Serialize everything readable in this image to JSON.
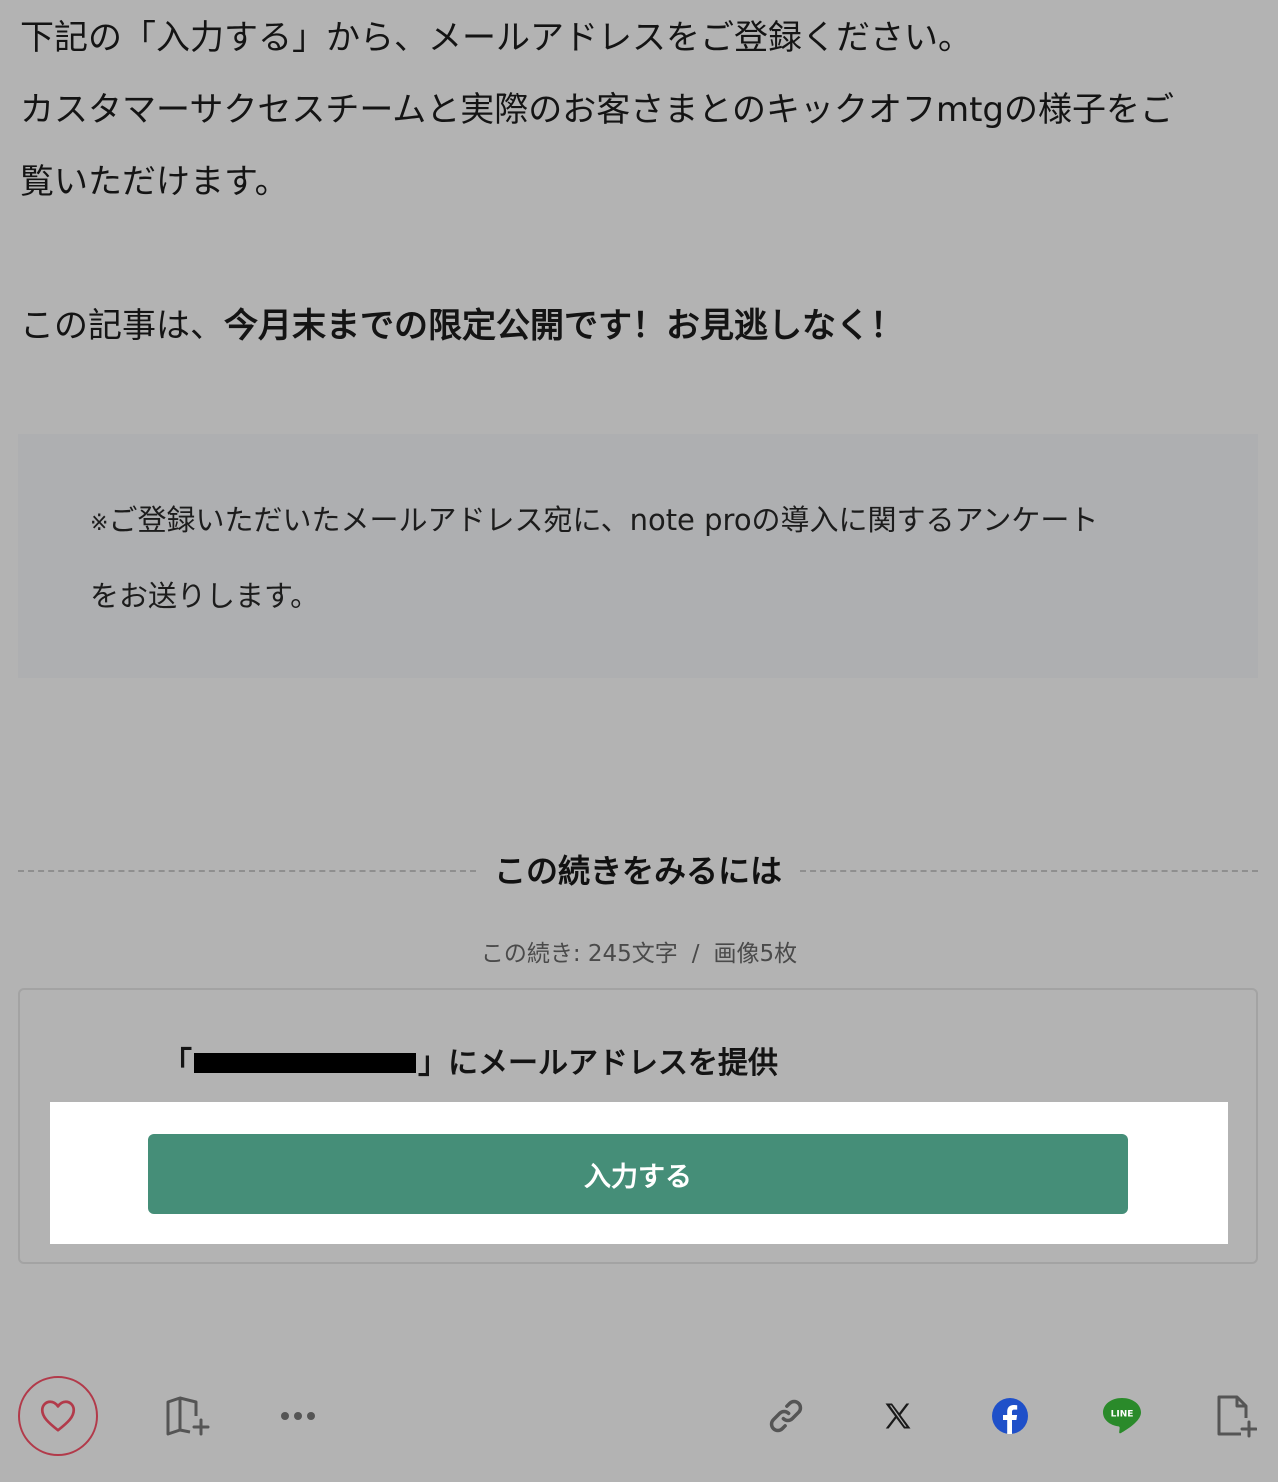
{
  "article": {
    "intro_line1": "下記の「入力する」から、メールアドレスをご登録ください。",
    "intro_line2": "カスタマーサクセスチームと実際のお客さまとのキックオフmtgの様子をご",
    "intro_line3": "覧いただけます。",
    "limited_prefix": "この記事は、",
    "limited_emphasis": "今月末までの限定公開です！お見逃しなく！"
  },
  "notice": {
    "mark": "※",
    "line1": "ご登録いただいたメールアドレス宛に、note proの導入に関するアンケート",
    "line2": "をお送りします。"
  },
  "paywall": {
    "divider_title": "この続きをみるには",
    "remaining_text": "この続き: 245文字",
    "separator": "/",
    "remaining_images": "画像5枚",
    "card_open_bracket": "「",
    "card_heading_suffix": "」にメールアドレスを提供",
    "submit_label": "入力する"
  },
  "action_bar": {
    "like_icon": "heart-icon",
    "magazine_icon": "magazine-add-icon",
    "more_icon": "more-dots-icon",
    "share_icons": [
      "link-icon",
      "x-logo-icon",
      "facebook-icon",
      "line-icon",
      "embed-add-icon"
    ],
    "line_logo_text": "LINE"
  },
  "colors": {
    "overlay_bg": "#b3b3b3",
    "button_green": "#458e78",
    "like_red": "#b23a4a",
    "facebook_blue": "#1f50c9",
    "line_green": "#2a8a2a"
  }
}
